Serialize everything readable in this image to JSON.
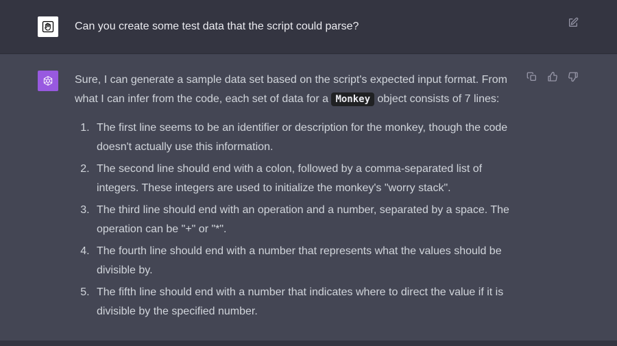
{
  "user": {
    "text": "Can you create some test data that the script could parse?"
  },
  "assistant": {
    "intro_pre": "Sure, I can generate a sample data set based on the script's expected input format. From what I can infer from the code, each set of data for a ",
    "code": "Monkey",
    "intro_post": " object consists of 7 lines:",
    "items": [
      "The first line seems to be an identifier or description for the monkey, though the code doesn't actually use this information.",
      "The second line should end with a colon, followed by a comma-separated list of integers. These integers are used to initialize the monkey's \"worry stack\".",
      "The third line should end with an operation and a number, separated by a space. The operation can be \"+\" or \"*\".",
      "The fourth line should end with a number that represents what the values should be divisible by.",
      "The fifth line should end with a number that indicates where to direct the value if it is divisible by the specified number."
    ]
  }
}
